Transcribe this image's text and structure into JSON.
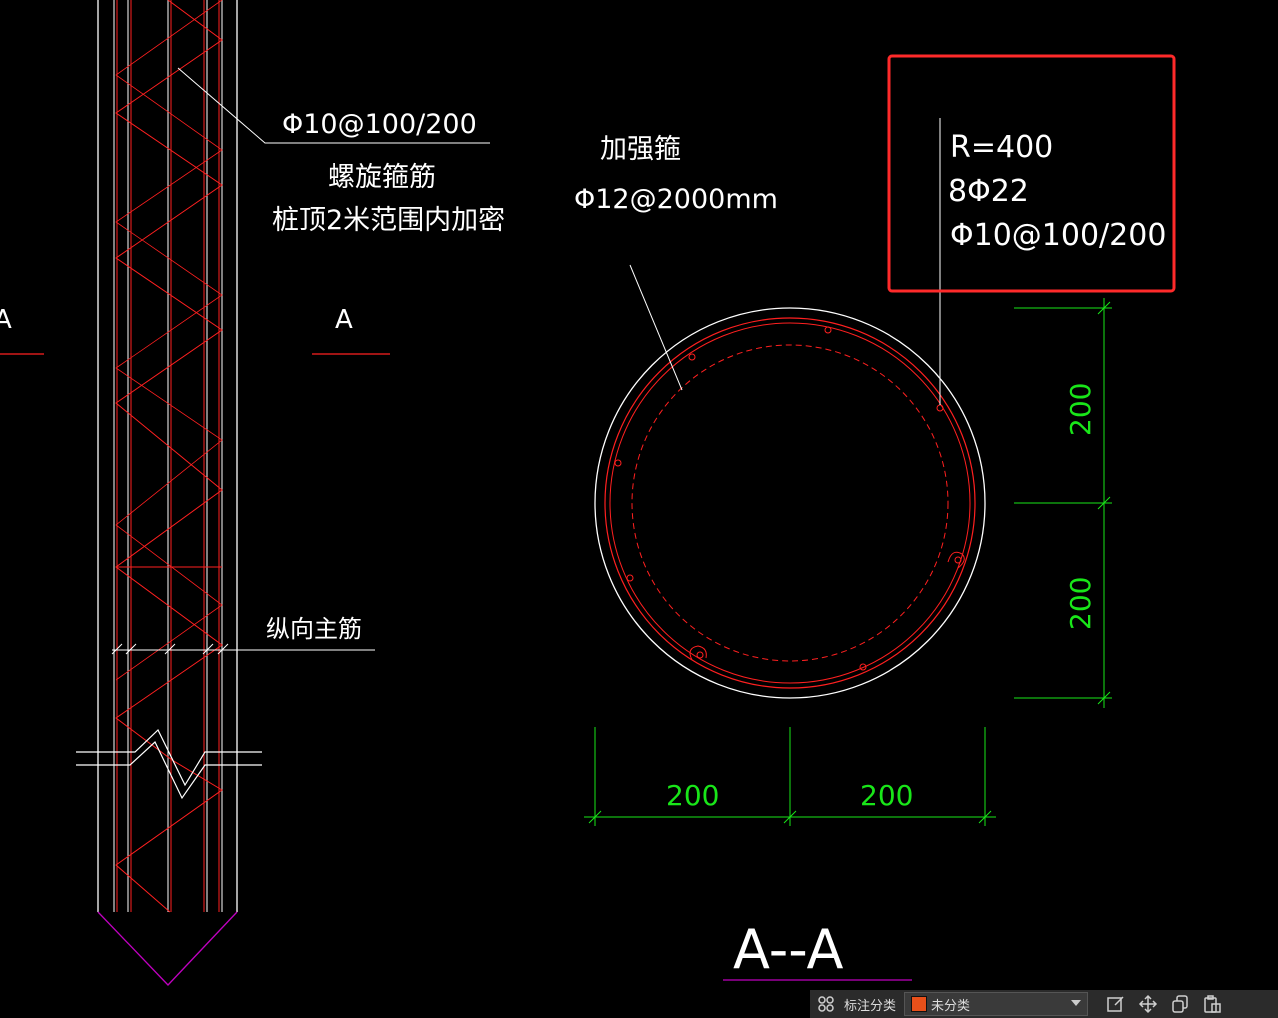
{
  "annotations": {
    "stirrup_spec": "Φ10@100/200",
    "spiral_label": "螺旋箍筋",
    "densify_note": "桩顶2米范围内加密",
    "section_mark_left": "A",
    "section_mark_right": "A",
    "reinforcing_label": "加强箍",
    "reinforcing_spec": "Φ12@2000mm",
    "longitudinal_label": "纵向主筋",
    "section_title": "A--A"
  },
  "info_box": {
    "radius": "R=400",
    "main_bars": "8Φ22",
    "stirrups": "Φ10@100/200"
  },
  "dimensions": {
    "vertical_top": "200",
    "vertical_bottom": "200",
    "horizontal_left": "200",
    "horizontal_right": "200"
  },
  "statusbar": {
    "grid_icon": "apps-grid-icon",
    "category_label": "标注分类",
    "category_value": "未分类",
    "category_color": "#e8501a",
    "tools": [
      "edit-icon",
      "move-icon",
      "copy-icon",
      "paste-icon"
    ]
  },
  "colors": {
    "white": "#ffffff",
    "red": "#ff2020",
    "green": "#19e619",
    "magenta": "#c000c0",
    "highlight": "#ff2a2a"
  }
}
